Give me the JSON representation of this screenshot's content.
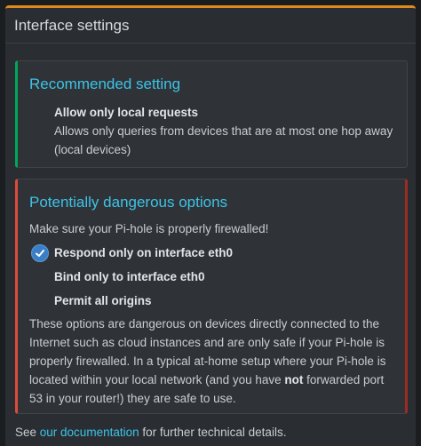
{
  "panel": {
    "title": "Interface settings"
  },
  "recommended": {
    "title": "Recommended setting",
    "option_label": "Allow only local requests",
    "option_description": "Allows only queries from devices that are at most one hop away (local devices)"
  },
  "dangerous": {
    "title": "Potentially dangerous options",
    "warning": "Make sure your Pi-hole is properly firewalled!",
    "options": [
      {
        "label": "Respond only on interface eth0",
        "selected": true
      },
      {
        "label": "Bind only to interface eth0",
        "selected": false
      },
      {
        "label": "Permit all origins",
        "selected": false
      }
    ],
    "explanation_before": "These options are dangerous on devices directly connected to the Internet such as cloud instances and are only safe if your Pi-hole is properly firewalled. In a typical at-home setup where your Pi-hole is located within your local network (and you have ",
    "explanation_bold": "not",
    "explanation_after": " forwarded port 53 in your router!) they are safe to use."
  },
  "footer": {
    "before": "See ",
    "link": "our documentation",
    "after": " for further technical details."
  },
  "colors": {
    "accent_orange": "#e08a1e",
    "success_green": "#00a65a",
    "danger_red": "#dd4b39",
    "link_blue": "#3dc3e6"
  }
}
